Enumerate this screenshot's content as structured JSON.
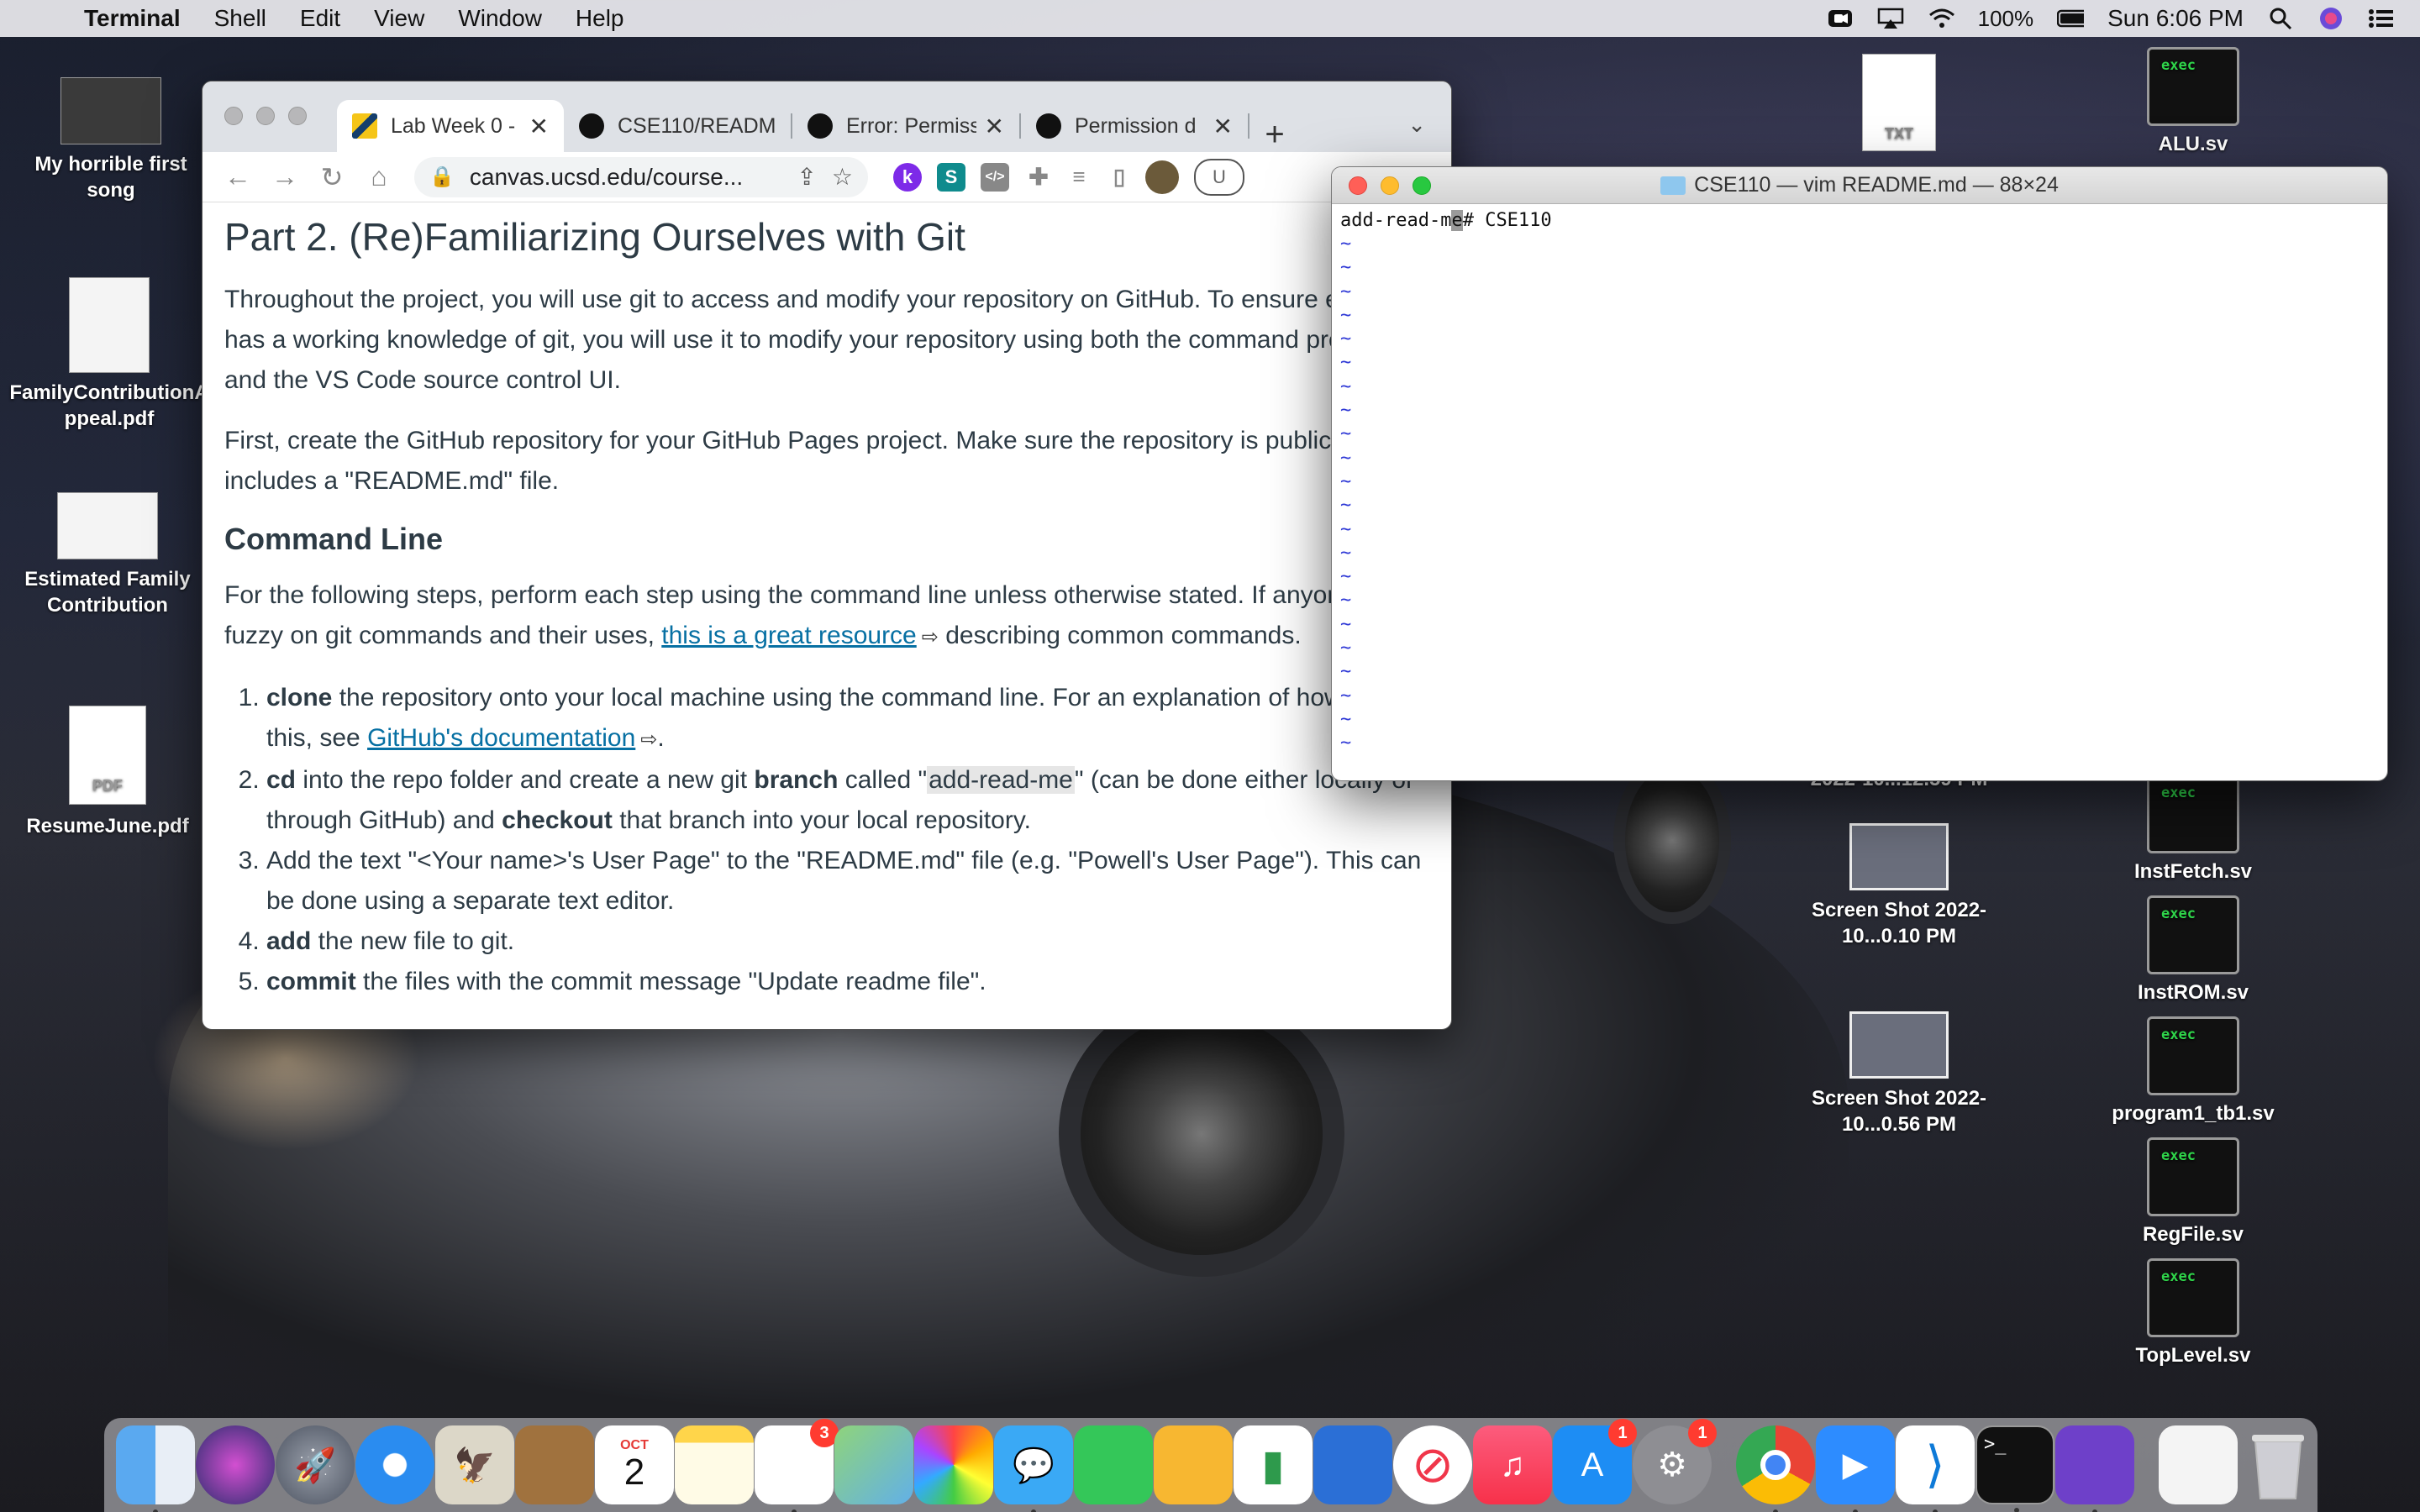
{
  "menubar": {
    "app_name": "Terminal",
    "items": [
      "Shell",
      "Edit",
      "View",
      "Window",
      "Help"
    ],
    "battery": "100%",
    "clock": "Sun 6:06 PM"
  },
  "desktop_left": [
    {
      "label": "My horrible first song"
    },
    {
      "label": "FamilyContributionAppeal.pdf"
    },
    {
      "label": "Estimated Family Contribution"
    },
    {
      "label": "ResumeJune.pdf",
      "thumb_text": "PDF"
    }
  ],
  "desktop_right": {
    "txt_label": "TXT",
    "exec_text": "exec",
    "items": [
      {
        "label": "ALU.sv"
      },
      {
        "label": "InstFetch.sv"
      },
      {
        "label": "InstROM.sv"
      },
      {
        "label": "program1_tb1.sv"
      },
      {
        "label": "RegFile.sv"
      },
      {
        "label": "TopLevel.sv"
      }
    ],
    "screenshots": [
      {
        "label": "Screen Shot 2022-10...0.10 PM"
      },
      {
        "label": "Screen Shot 2022-10...0.56 PM"
      }
    ],
    "partial_label": "2022-10...12.59 PM"
  },
  "browser": {
    "tabs": [
      {
        "title": "Lab Week 0 -"
      },
      {
        "title": "CSE110/README"
      },
      {
        "title": "Error: Permiss"
      },
      {
        "title": "Permission d"
      }
    ],
    "url": "canvas.ucsd.edu/course...",
    "ext_letters": [
      "k",
      "S",
      "</>"
    ],
    "profile_text": "U",
    "page": {
      "heading": "Part 2. (Re)Familiarizing Ourselves with Git",
      "p1": "Throughout the project, you will use git to access and modify your repository on GitHub. To ensure everyone has a working knowledge of git, you will use it to modify your repository using both the command prompt and the VS Code source control UI.",
      "p2": "First, create the GitHub repository for your GitHub Pages project. Make sure the repository is public and includes a \"README.md\" file.",
      "subheading": "Command Line",
      "p3_before": "For the following steps, perform each step using the command line unless otherwise stated. If anyone is fuzzy on git commands and their uses, ",
      "p3_link": "this is a great resource",
      "p3_after": " describing common commands.",
      "steps": [
        {
          "bold": "clone",
          "text": " the repository onto your local machine using the command line. For an explanation of how to do this, see ",
          "link": "GitHub's documentation",
          "end": "."
        },
        {
          "bold": "cd",
          "text": " into the repo folder and create a new git ",
          "bold2": "branch",
          "text2": " called \"",
          "code": "add-read-me",
          "text3": "\" (can be done either locally or through GitHub) and ",
          "bold3": "checkout",
          "text4": " that branch into your local repository."
        },
        {
          "text": "Add the text \"<Your name>'s User Page\" to the \"README.md\" file (e.g. \"Powell's User Page\"). This can be done using a separate text editor."
        },
        {
          "bold": "add",
          "text": " the new file to git."
        },
        {
          "bold": "commit",
          "text": " the files with the commit message \"Update readme file\"."
        }
      ]
    }
  },
  "terminal": {
    "title": "CSE110 — vim README.md — 88×24",
    "line_prefix": "add-read-m",
    "cursor_char": "e",
    "line_suffix": "# CSE110",
    "tilde_count": 22
  },
  "dock": {
    "calendar_month": "OCT",
    "calendar_day": "2",
    "badges": {
      "reminders": "3",
      "appstore": "1",
      "settings": "1"
    },
    "terminal_glyph": ">_"
  }
}
